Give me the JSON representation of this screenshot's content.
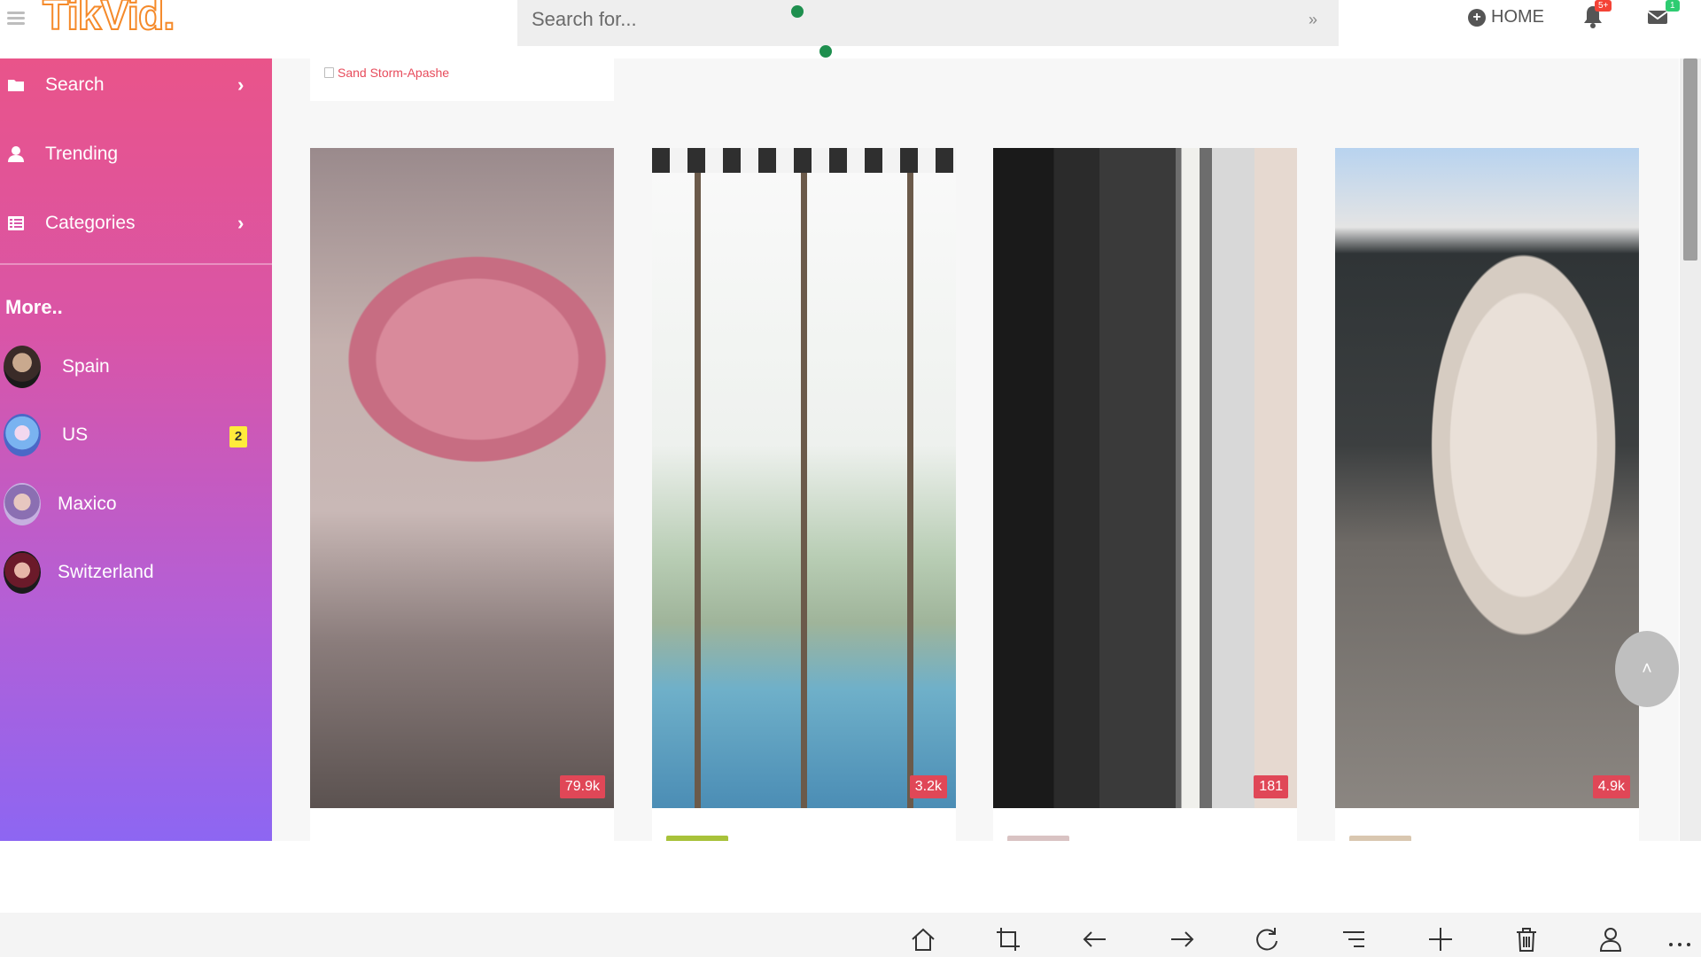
{
  "header": {
    "logo_text": "TikVid.",
    "search_placeholder": "Search for...",
    "search_go": "»",
    "home_label": "HOME",
    "notif_badge": "5+",
    "mail_badge": "1"
  },
  "sidebar": {
    "nav": [
      {
        "label": "Search",
        "icon": "folder-icon",
        "chevron": "›"
      },
      {
        "label": "Trending",
        "icon": "user-icon"
      },
      {
        "label": "Categories",
        "icon": "list-icon",
        "chevron": "›"
      }
    ],
    "more_title": "More..",
    "countries": [
      {
        "label": "Spain"
      },
      {
        "label": "US",
        "count": "2"
      },
      {
        "label": "Maxico"
      },
      {
        "label": "Switzerland"
      }
    ]
  },
  "content": {
    "previous_tag": "Sand Storm-Apashe",
    "videos": [
      {
        "views": "79.9k"
      },
      {
        "views": "3.2k"
      },
      {
        "views": "181"
      },
      {
        "views": "4.9k"
      }
    ]
  },
  "colors": {
    "accent_red": "#e04757",
    "sidebar_top": "#e9548a",
    "sidebar_bottom": "#8d66f2",
    "logo_orange": "#f58a2a"
  },
  "taskbar": {
    "icons": [
      "home-icon",
      "crop-icon",
      "back-arrow-icon",
      "forward-arrow-icon",
      "refresh-icon",
      "menu-icon",
      "add-icon",
      "trash-icon",
      "profile-icon",
      "more-icon"
    ]
  }
}
